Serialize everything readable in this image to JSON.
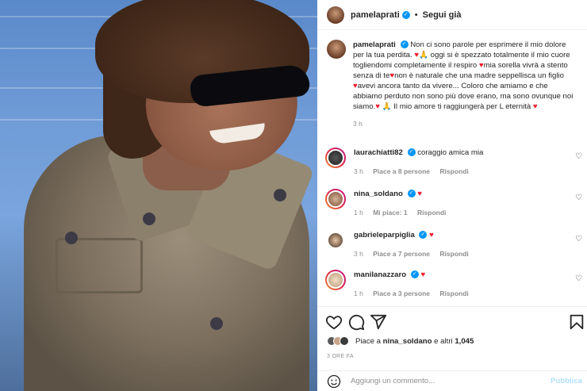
{
  "post": {
    "author": "pamelaprati",
    "follow_label": "Segui già",
    "caption_text_1": "Non ci sono parole per esprimere il mio dolore per la tua perdita. ",
    "caption_text_2": " oggi si è spezzato totalmente il mio cuore togliendomi completamente il respiro ",
    "caption_text_3": "mia sorella vivrà a stento senza di te",
    "caption_text_4": "non è naturale che una madre seppellisca un figlio ",
    "caption_text_5": "avevi ancora tanto da vivere... Coloro che amiamo e che abbiamo perduto non sono più dove erano, ma sono ovunque noi siamo.",
    "caption_text_6": " Il mio amore ti raggiungerà per L eternità ",
    "time": "3 h"
  },
  "comments": [
    {
      "user": "laurachiatti82",
      "text": "coraggio amica mia",
      "time": "3 h",
      "likes": "Piace a 8 persone",
      "reply": "Rispondi"
    },
    {
      "user": "nina_soldano",
      "time": "1 h",
      "likes": "Mi piace: 1",
      "reply": "Rispondi"
    },
    {
      "user": "gabrieleparpiglia",
      "time": "3 h",
      "likes": "Piace a 7 persone",
      "reply": "Rispondi"
    },
    {
      "user": "manilanazzaro",
      "time": "1 h",
      "likes": "Piace a 3 persone",
      "reply": "Rispondi"
    }
  ],
  "likes_bar": {
    "prefix": "Piace a ",
    "user": "nina_soldano",
    "suffix": " e altri ",
    "count": "1,045"
  },
  "posted_ago": "3 ORE FA",
  "add_comment": {
    "placeholder": "Aggiungi un commento...",
    "publish": "Pubblica"
  },
  "icons": {
    "heart": "heart-icon",
    "comment": "comment-icon",
    "share": "share-icon",
    "save": "bookmark-icon",
    "emoji": "emoji-icon",
    "verified": "verified-badge-icon"
  },
  "colors": {
    "accent": "#0095f6",
    "heart": "#ed1b2e",
    "muted": "#8e8e8e"
  }
}
